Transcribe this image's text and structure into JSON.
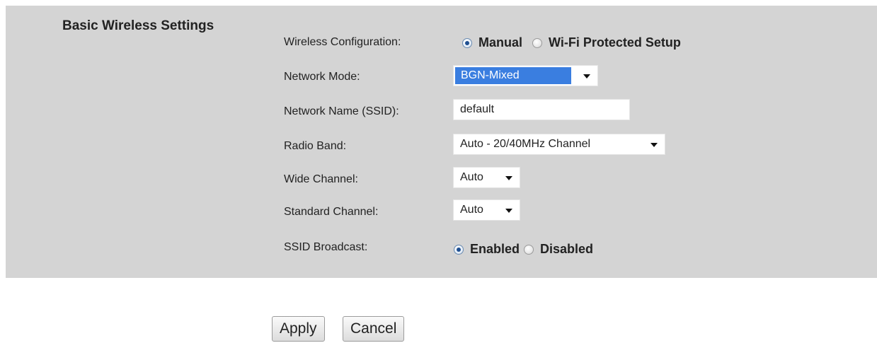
{
  "section_title": "Basic Wireless Settings",
  "wireless_config": {
    "label": "Wireless Configuration:",
    "options": [
      "Manual",
      "Wi-Fi Protected Setup"
    ],
    "selected": "Manual"
  },
  "network_mode": {
    "label": "Network Mode:",
    "value": "BGN-Mixed"
  },
  "ssid": {
    "label": "Network Name (SSID):",
    "value": "default"
  },
  "radio_band": {
    "label": "Radio Band:",
    "value": "Auto - 20/40MHz Channel"
  },
  "wide_channel": {
    "label": "Wide Channel:",
    "value": "Auto"
  },
  "standard_channel": {
    "label": "Standard Channel:",
    "value": "Auto"
  },
  "ssid_broadcast": {
    "label": "SSID Broadcast:",
    "options": [
      "Enabled",
      "Disabled"
    ],
    "selected": "Enabled"
  },
  "buttons": {
    "apply": "Apply",
    "cancel": "Cancel"
  },
  "colors": {
    "panel_bg": "#d4d4d4",
    "selection_highlight": "#3a7ee0",
    "radio_dot": "#1f4f91"
  }
}
